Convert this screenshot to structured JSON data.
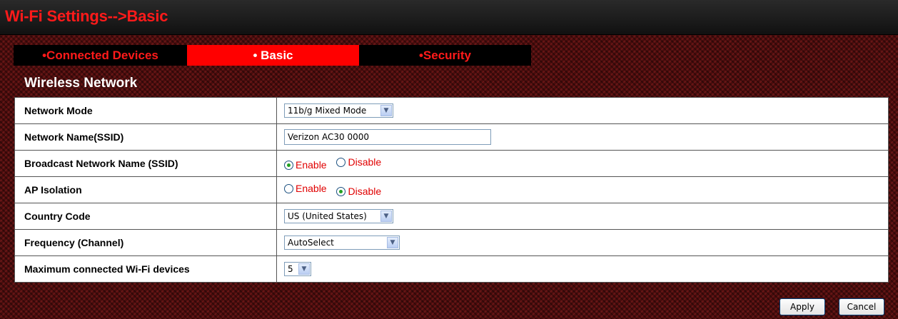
{
  "header": {
    "title": "Wi-Fi Settings-->Basic"
  },
  "tabs": [
    {
      "label": "•Connected Devices",
      "active": false
    },
    {
      "label": "• Basic",
      "active": true
    },
    {
      "label": "•Security",
      "active": false
    }
  ],
  "section": {
    "title": "Wireless Network"
  },
  "settings": {
    "network_mode": {
      "label": "Network Mode",
      "value": "11b/g Mixed Mode"
    },
    "ssid": {
      "label": "Network Name(SSID)",
      "value": "Verizon AC30 0000"
    },
    "broadcast": {
      "label": "Broadcast Network Name (SSID)",
      "enable_label": "Enable",
      "disable_label": "Disable",
      "selected": "Enable"
    },
    "ap_isolation": {
      "label": "AP Isolation",
      "enable_label": "Enable",
      "disable_label": "Disable",
      "selected": "Disable"
    },
    "country_code": {
      "label": "Country Code",
      "value": "US (United States)"
    },
    "frequency": {
      "label": "Frequency (Channel)",
      "value": "AutoSelect"
    },
    "max_devices": {
      "label": "Maximum connected Wi-Fi devices",
      "value": "5"
    }
  },
  "buttons": {
    "apply": "Apply",
    "cancel": "Cancel"
  },
  "colors": {
    "accent": "#ff1a1a",
    "active_tab": "#ff0000",
    "radio_label": "#e00000"
  },
  "icons": {
    "dropdown": "chevron-down-icon"
  }
}
